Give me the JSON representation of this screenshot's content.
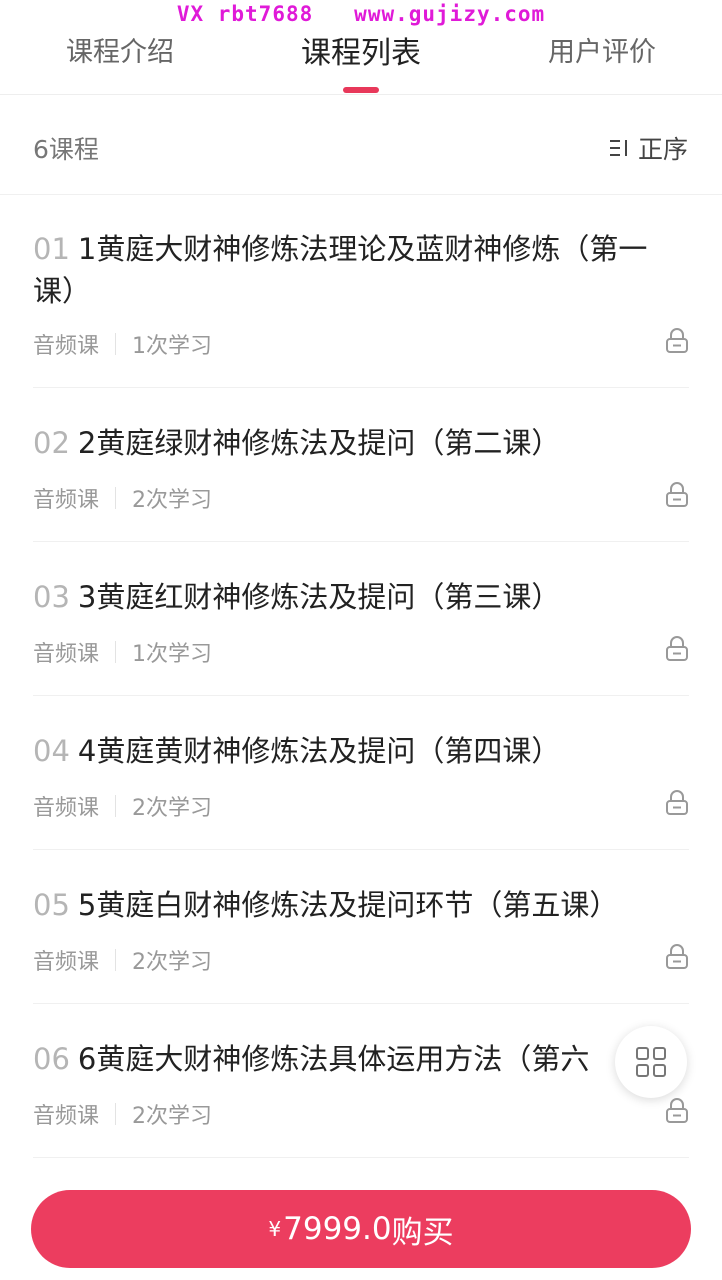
{
  "watermark": "VX rbt7688   www.gujizy.com",
  "tabs": [
    {
      "label": "课程介绍"
    },
    {
      "label": "课程列表"
    },
    {
      "label": "用户评价"
    }
  ],
  "active_tab": 1,
  "list_header": {
    "count": "6课程",
    "sort_label": "正序",
    "sort_icon": "sort-icon"
  },
  "courses": [
    {
      "index": "01",
      "title": "1黄庭大财神修炼法理论及蓝财神修炼（第一课）",
      "type": "音频课",
      "learned": "1次学习",
      "locked": true
    },
    {
      "index": "02",
      "title": "2黄庭绿财神修炼法及提问（第二课）",
      "type": "音频课",
      "learned": "2次学习",
      "locked": true
    },
    {
      "index": "03",
      "title": "3黄庭红财神修炼法及提问（第三课）",
      "type": "音频课",
      "learned": "1次学习",
      "locked": true
    },
    {
      "index": "04",
      "title": "4黄庭黄财神修炼法及提问（第四课）",
      "type": "音频课",
      "learned": "2次学习",
      "locked": true
    },
    {
      "index": "05",
      "title": "5黄庭白财神修炼法及提问环节（第五课）",
      "type": "音频课",
      "learned": "2次学习",
      "locked": true
    },
    {
      "index": "06",
      "title": "6黄庭大财神修炼法具体运用方法（第六",
      "type": "音频课",
      "learned": "2次学习",
      "locked": true
    }
  ],
  "fab_icon": "grid-icon",
  "buy": {
    "currency": "¥",
    "price": "7999.0",
    "label": "购买"
  },
  "colors": {
    "accent": "#ec3d5f",
    "watermark": "#e01ad8"
  }
}
